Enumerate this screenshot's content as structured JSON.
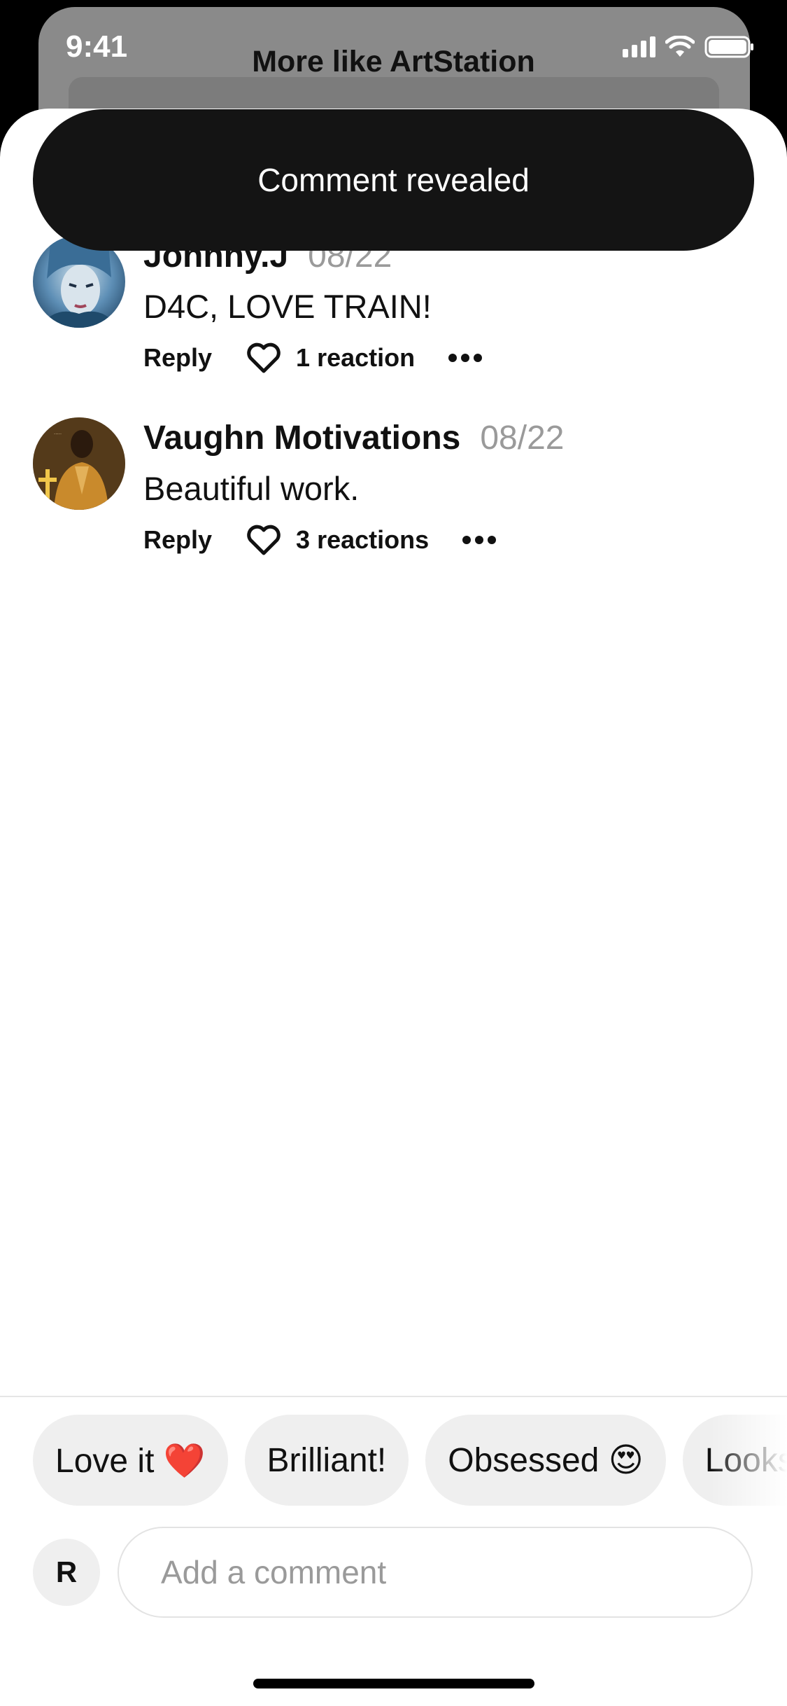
{
  "status_bar": {
    "time": "9:41",
    "title": "More like ArtStation"
  },
  "toast": {
    "text": "Comment revealed"
  },
  "comments": [
    {
      "author": "Johnny.J",
      "date": "08/22",
      "text": "D4C, LOVE TRAIN!",
      "reply_label": "Reply",
      "reactions_label": "1 reaction"
    },
    {
      "author": "Vaughn Motivations",
      "date": "08/22",
      "text": "Beautiful work.",
      "reply_label": "Reply",
      "reactions_label": "3 reactions"
    }
  ],
  "quick_replies": [
    {
      "label": "Love it ❤️"
    },
    {
      "label": "Brilliant!"
    },
    {
      "label": "Obsessed 😍"
    },
    {
      "label": "Looks great"
    }
  ],
  "composer": {
    "user_initial": "R",
    "placeholder": "Add a comment"
  },
  "icons": [
    "signal-icon",
    "wifi-icon",
    "battery-icon",
    "heart-icon",
    "more-icon"
  ],
  "colors": {
    "toast_bg": "#141414",
    "chip_bg": "#efefef",
    "muted_text": "#9a9a9a"
  }
}
